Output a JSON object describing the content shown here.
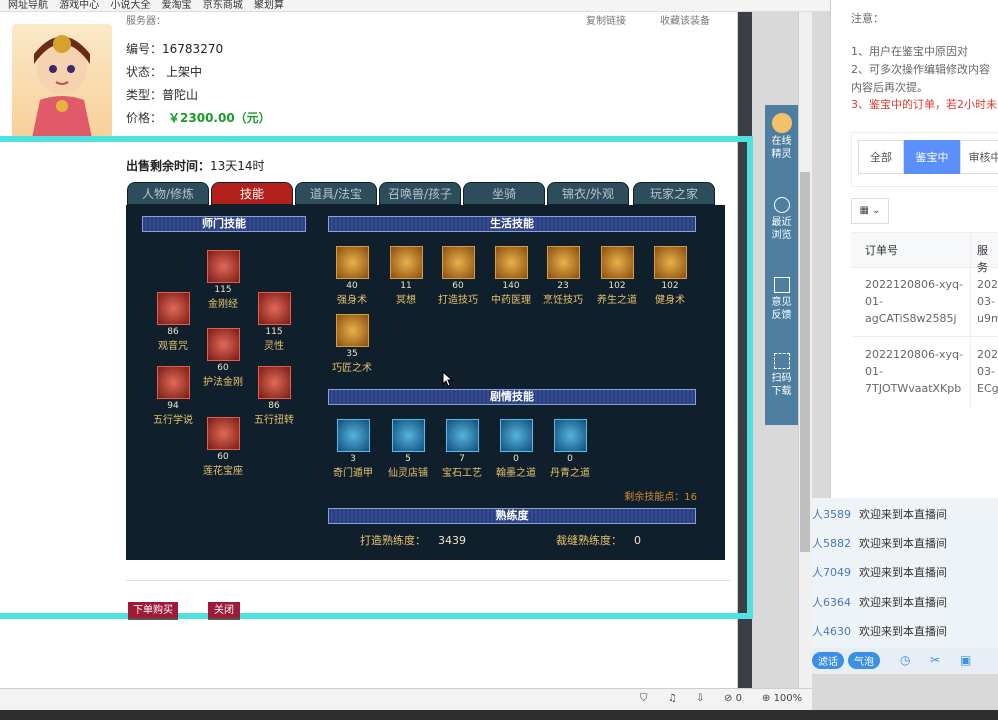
{
  "bookmarks": [
    "网址导航",
    "游戏中心",
    "小说大全",
    "爱淘宝",
    "京东商城",
    "聚划算"
  ],
  "top_info": {
    "server_label": "服务器：",
    "watch_label": "收藏该装备",
    "share_label": "复制链接"
  },
  "item": {
    "id_label": "编号：",
    "id": "16783270",
    "status_label": "状态：",
    "status": "上架中",
    "type_label": "类型：",
    "type": "普陀山",
    "price_label": "价格：",
    "price": "￥2300.00（元）",
    "remaining_label": "出售剩余时间：",
    "remaining": "13天14时"
  },
  "tabs": [
    "人物/修炼",
    "技能",
    "道具/法宝",
    "召唤兽/孩子",
    "坐骑",
    "锦衣/外观",
    "玩家之家"
  ],
  "sections": {
    "master": "师门技能",
    "life": "生活技能",
    "plot": "剧情技能",
    "proficiency": "熟练度"
  },
  "master_skills": [
    {
      "name": "金刚经",
      "level": "115"
    },
    {
      "name": "观音咒",
      "level": "86"
    },
    {
      "name": "灵性",
      "level": "115"
    },
    {
      "name": "护法金刚",
      "level": "60"
    },
    {
      "name": "五行学说",
      "level": "94"
    },
    {
      "name": "五行扭转",
      "level": "86"
    },
    {
      "name": "莲花宝座",
      "level": "60"
    }
  ],
  "life_skills": [
    {
      "name": "强身术",
      "level": "40"
    },
    {
      "name": "冥想",
      "level": "11"
    },
    {
      "name": "打造技巧",
      "level": "60"
    },
    {
      "name": "中药医理",
      "level": "140"
    },
    {
      "name": "烹饪技巧",
      "level": "23"
    },
    {
      "name": "养生之道",
      "level": "102"
    },
    {
      "name": "健身术",
      "level": "102"
    },
    {
      "name": "巧匠之术",
      "level": "35"
    }
  ],
  "plot_skills": [
    {
      "name": "奇门遁甲",
      "level": "3"
    },
    {
      "name": "仙灵店铺",
      "level": "5"
    },
    {
      "name": "宝石工艺",
      "level": "7"
    },
    {
      "name": "翰墨之道",
      "level": "0"
    },
    {
      "name": "丹青之道",
      "level": "0"
    }
  ],
  "remaining_points": "剩余技能点：16",
  "proficiency": {
    "forge_label": "打造熟练度：",
    "forge": "3439",
    "tailor_label": "裁缝熟练度：",
    "tailor": "0"
  },
  "buttons": {
    "buy": "下单购买",
    "close": "关闭"
  },
  "sidebar": [
    {
      "label": "在线精灵"
    },
    {
      "label": "最近浏览"
    },
    {
      "label": "意见反馈"
    },
    {
      "label": "扫码下载"
    }
  ],
  "right_panel": {
    "notice_title": "注意：",
    "notice_lines": [
      "1、用户在鉴宝中原因对",
      "2、可多次操作编辑修改内容",
      "内容后再次提。",
      "3、鉴宝中的订单，若2小时未"
    ],
    "segments": [
      "全部",
      "鉴宝中",
      "审核中"
    ],
    "columns": [
      "订单号",
      "服务"
    ],
    "orders": [
      {
        "id_lines": [
          "2022120806-xyq-",
          "01-",
          "agCATiS8w2585j"
        ],
        "service_lines": [
          "2022",
          "03-",
          "u9m"
        ]
      },
      {
        "id_lines": [
          "2022120806-xyq-",
          "01-",
          "7TJOTWvaatXKpb"
        ],
        "service_lines": [
          "2022",
          "03-",
          "ECg"
        ]
      }
    ]
  },
  "chat": [
    {
      "user": "人3589",
      "msg": "欢迎来到本直播间"
    },
    {
      "user": "人5882",
      "msg": "欢迎来到本直播间"
    },
    {
      "user": "人7049",
      "msg": "欢迎来到本直播间"
    },
    {
      "user": "人6364",
      "msg": "欢迎来到本直播间"
    },
    {
      "user": "人4630",
      "msg": "欢迎来到本直播间"
    }
  ],
  "chat_bar": [
    "滤话",
    "气泡"
  ],
  "status_bar": {
    "zoom": "100%",
    "count": "0"
  }
}
